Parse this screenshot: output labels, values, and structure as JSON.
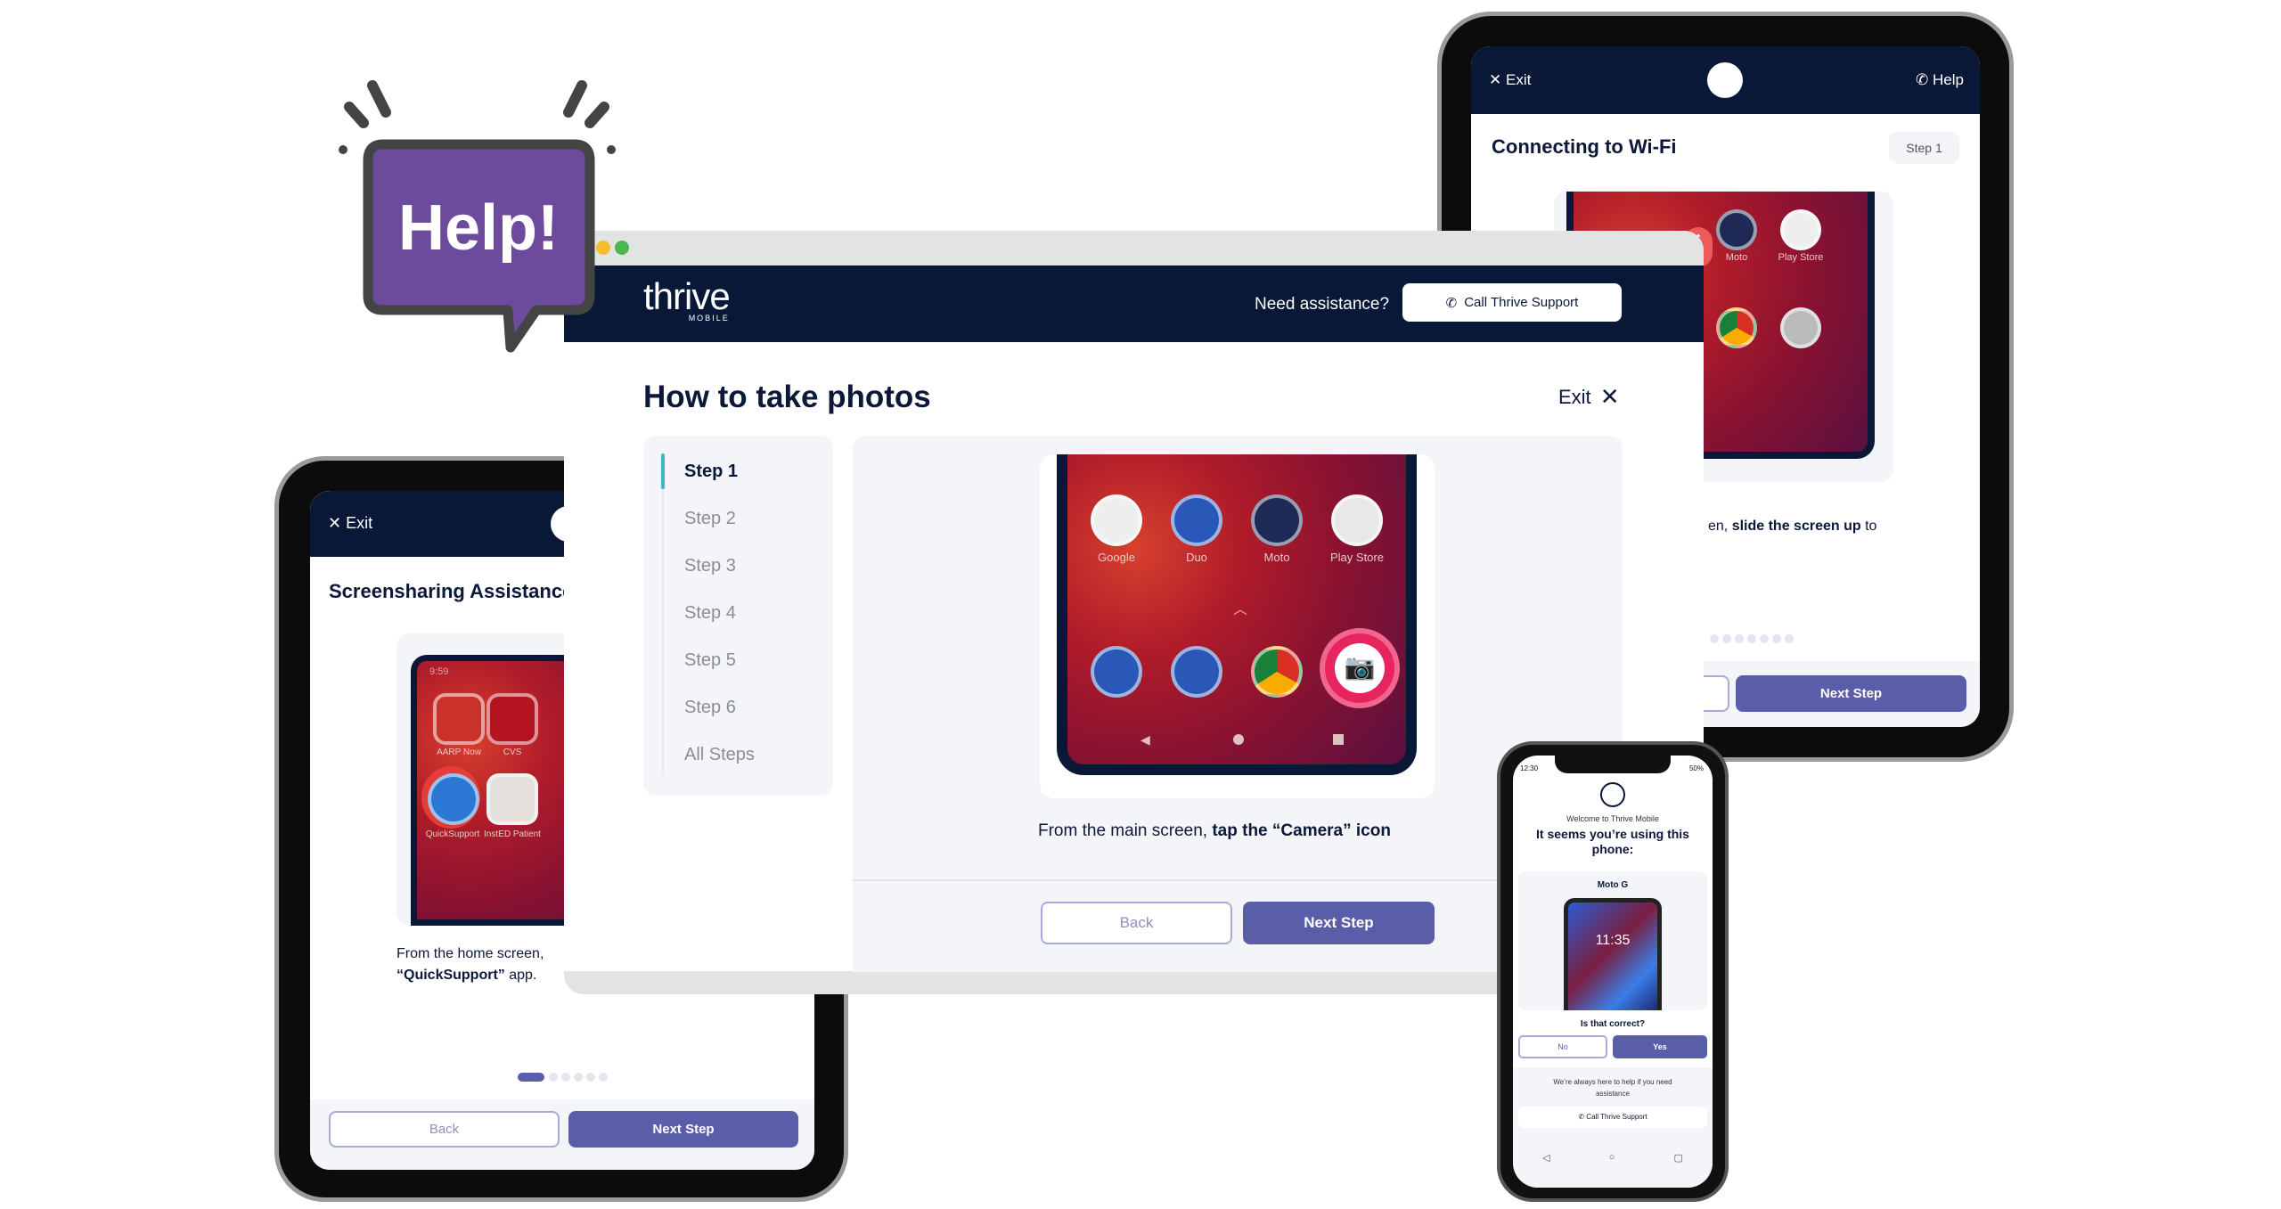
{
  "help_bubble": {
    "text": "Help!",
    "fill": "#6c4a9c",
    "outline": "#444444"
  },
  "browser": {
    "window_dots": [
      "#f8bd2f",
      "#4cb74e"
    ],
    "header": {
      "logo": "thrive",
      "logo_sub": "MOBILE",
      "assistance_text": "Need assistance?",
      "call_button": "Call Thrive Support",
      "call_icon": "phone-icon"
    },
    "page_title": "How to take photos",
    "exit_label": "Exit",
    "steps": [
      {
        "label": "Step 1",
        "active": true
      },
      {
        "label": "Step 2"
      },
      {
        "label": "Step 3"
      },
      {
        "label": "Step 4"
      },
      {
        "label": "Step 5"
      },
      {
        "label": "Step 6"
      },
      {
        "label": "All Steps"
      }
    ],
    "screen_apps": [
      "Google",
      "Duo",
      "Moto",
      "Play Store"
    ],
    "caption_prefix": "From the main screen, ",
    "caption_bold": "tap the “Camera” icon",
    "back_label": "Back",
    "next_label": "Next Step",
    "colors": {
      "navy": "#0a1838",
      "accent": "#5a5ea9",
      "step_indicator": "#3fb8c8"
    }
  },
  "right_tablet": {
    "exit_label": "Exit",
    "help_label": "Help",
    "title": "Connecting to Wi-Fi",
    "step_badge": "Step 1",
    "screen_apps": [
      "Moto",
      "Play Store"
    ],
    "caption_prefix": "en, ",
    "caption_bold": "slide the screen up",
    "caption_suffix": " to",
    "next_label": "Next Step"
  },
  "left_tablet": {
    "exit_label": "Exit",
    "title": "Screensharing Assistance",
    "screen_time": "9:59",
    "screen_apps": [
      "AARP Now",
      "CVS",
      "QuickSupport",
      "InstED Patient"
    ],
    "caption_line1": "From the home screen,",
    "caption_bold": "“QuickSupport”",
    "caption_suffix": " app.",
    "progress": {
      "current": 1,
      "total": 6
    },
    "back_label": "Back",
    "next_label": "Next Step"
  },
  "phone": {
    "status_time": "12:30",
    "battery": "50%",
    "welcome": "Welcome to Thrive Mobile",
    "heading": "It seems you’re using this phone:",
    "device_name": "Moto G",
    "device_clock": "11:35",
    "question": "Is that correct?",
    "no_label": "No",
    "yes_label": "Yes",
    "help_text": "We’re always here to help if you need assistance",
    "call_button": "Call Thrive Support"
  }
}
